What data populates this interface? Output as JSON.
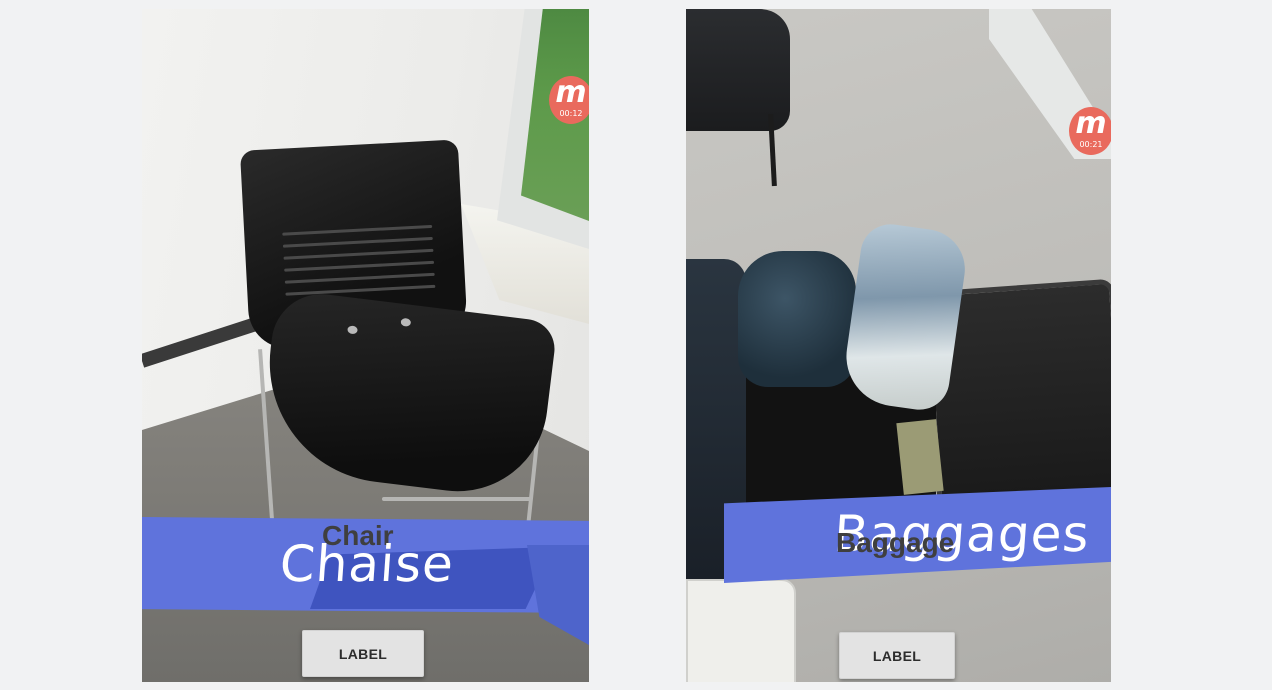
{
  "screens": [
    {
      "english_label": "Chair",
      "translated_label": "Chaise",
      "recording_badge": {
        "icon": "recorder-m-icon",
        "time": "00:12"
      },
      "button_label": "LABEL"
    },
    {
      "english_label": "Baggage",
      "translated_label": "Baggages",
      "recording_badge": {
        "icon": "recorder-m-icon",
        "time": "00:21"
      },
      "button_label": "LABEL"
    }
  ],
  "colors": {
    "banner": "#5f73dc",
    "badge": "#e96a5d",
    "button": "#e3e3e3",
    "page_background": "#f1f2f3"
  }
}
